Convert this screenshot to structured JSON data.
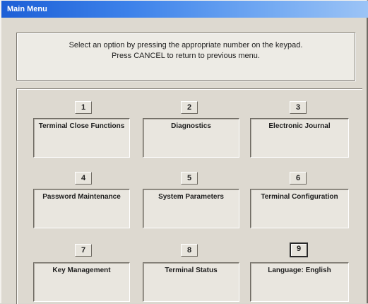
{
  "window": {
    "title": "Main Menu"
  },
  "instructions": {
    "line1": "Select an option by pressing the appropriate number on the keypad.",
    "line2": "Press CANCEL to return to previous menu."
  },
  "options": [
    {
      "number": "1",
      "label": "Terminal Close Functions"
    },
    {
      "number": "2",
      "label": "Diagnostics"
    },
    {
      "number": "3",
      "label": "Electronic Journal"
    },
    {
      "number": "4",
      "label": "Password Maintenance"
    },
    {
      "number": "5",
      "label": "System Parameters"
    },
    {
      "number": "6",
      "label": "Terminal Configuration"
    },
    {
      "number": "7",
      "label": "Key Management"
    },
    {
      "number": "8",
      "label": "Terminal Status"
    },
    {
      "number": "9",
      "label": "Language: English"
    }
  ]
}
